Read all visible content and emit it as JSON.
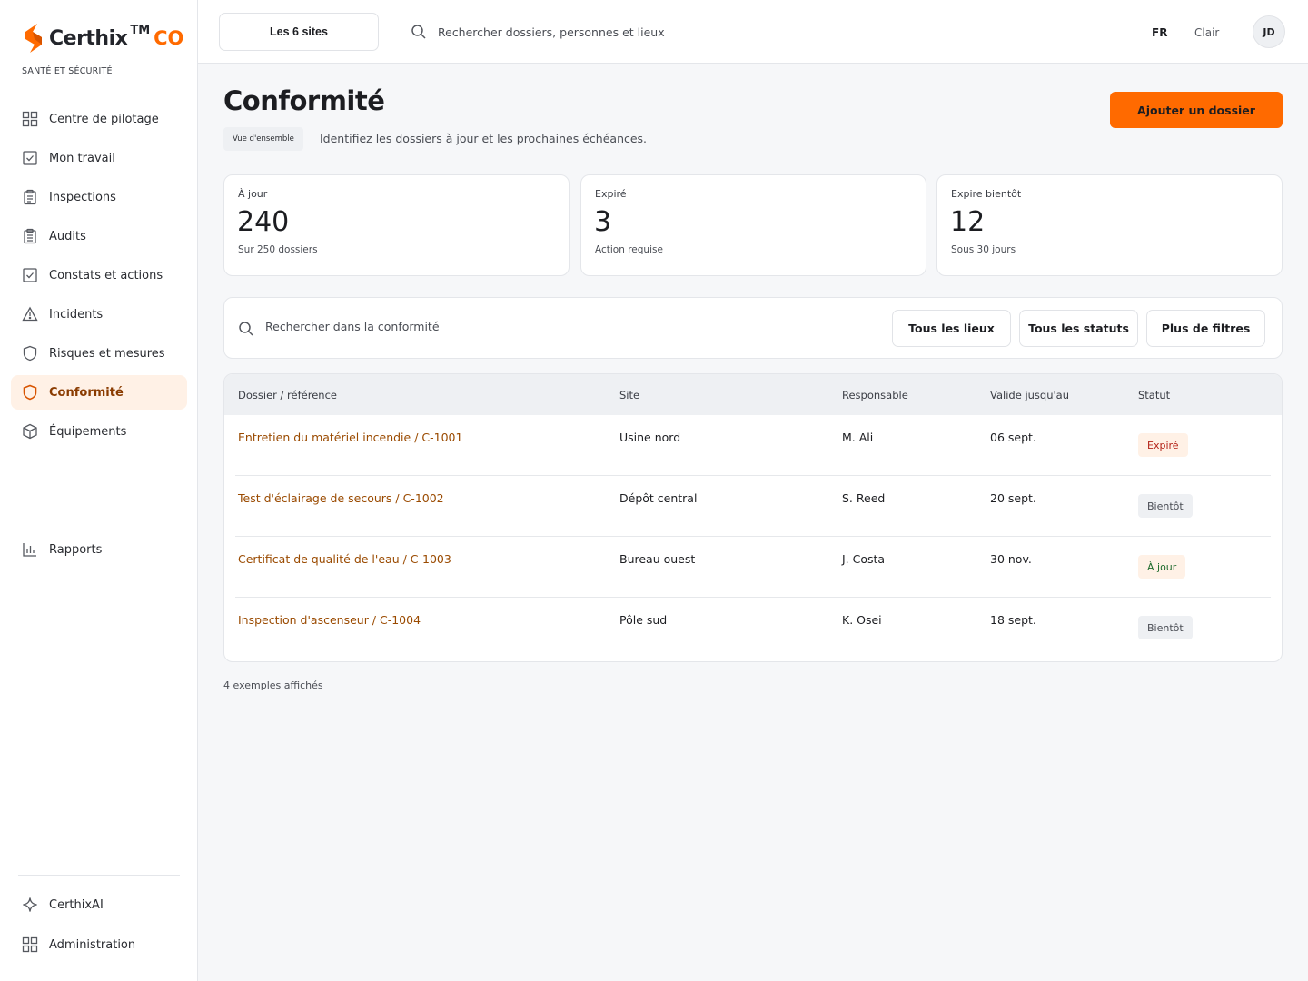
{
  "brand": {
    "name": "Certhix",
    "tm": "TM",
    "suffix": "CO",
    "tagline": "SANTÉ ET SÉCURITÉ",
    "accent_color": "#ff6a00"
  },
  "sidebar": {
    "items": [
      {
        "label": "Centre de pilotage",
        "icon": "dashboard-grid-icon"
      },
      {
        "label": "Mon travail",
        "icon": "checkbox-icon"
      },
      {
        "label": "Inspections",
        "icon": "clipboard-icon"
      },
      {
        "label": "Audits",
        "icon": "clipboard-list-icon"
      },
      {
        "label": "Constats et actions",
        "icon": "checkbox-icon"
      },
      {
        "label": "Incidents",
        "icon": "warning-triangle-icon"
      },
      {
        "label": "Risques et mesures",
        "icon": "shield-icon"
      },
      {
        "label": "Conformité",
        "icon": "shield-icon",
        "active": true
      },
      {
        "label": "Équipements",
        "icon": "cube-icon"
      }
    ],
    "reports": {
      "label": "Rapports",
      "icon": "bar-chart-icon"
    },
    "bottom": [
      {
        "label": "CerthixAI",
        "icon": "sparkle-icon"
      },
      {
        "label": "Administration",
        "icon": "dashboard-grid-icon"
      }
    ]
  },
  "topbar": {
    "site_selector": "Les 6 sites",
    "search_placeholder": "Rechercher dossiers, personnes et lieux",
    "language": "FR",
    "theme": "Clair",
    "user_initials": "JD"
  },
  "header": {
    "title": "Conformité",
    "badge": "Vue d'ensemble",
    "subtitle": "Identifiez les dossiers à jour et les prochaines échéances.",
    "add_button": "Ajouter un dossier"
  },
  "stats": [
    {
      "label": "À jour",
      "value": "240",
      "note": "Sur 250 dossiers"
    },
    {
      "label": "Expiré",
      "value": "3",
      "note": "Action requise"
    },
    {
      "label": "Expire bientôt",
      "value": "12",
      "note": "Sous 30 jours"
    }
  ],
  "filters": {
    "search_placeholder": "Rechercher dans la conformité",
    "locations": "Tous les lieux",
    "statuses": "Tous les statuts",
    "more": "Plus de filtres"
  },
  "table": {
    "columns": [
      "Dossier / référence",
      "Site",
      "Responsable",
      "Valide jusqu'au",
      "Statut"
    ],
    "rows": [
      {
        "dossier": "Entretien du matériel incendie / C-1001",
        "site": "Usine nord",
        "owner": "M. Ali",
        "valid_until": "06 sept.",
        "status": "Expiré",
        "status_kind": "expired"
      },
      {
        "dossier": "Test d'éclairage de secours / C-1002",
        "site": "Dépôt central",
        "owner": "S. Reed",
        "valid_until": "20 sept.",
        "status": "Bientôt",
        "status_kind": "soon"
      },
      {
        "dossier": "Certificat de qualité de l'eau / C-1003",
        "site": "Bureau ouest",
        "owner": "J. Costa",
        "valid_until": "30 nov.",
        "status": "À jour",
        "status_kind": "ok"
      },
      {
        "dossier": "Inspection d'ascenseur / C-1004",
        "site": "Pôle sud",
        "owner": "K. Osei",
        "valid_until": "18 sept.",
        "status": "Bientôt",
        "status_kind": "soon"
      }
    ]
  },
  "footer_note": "4 exemples affichés"
}
